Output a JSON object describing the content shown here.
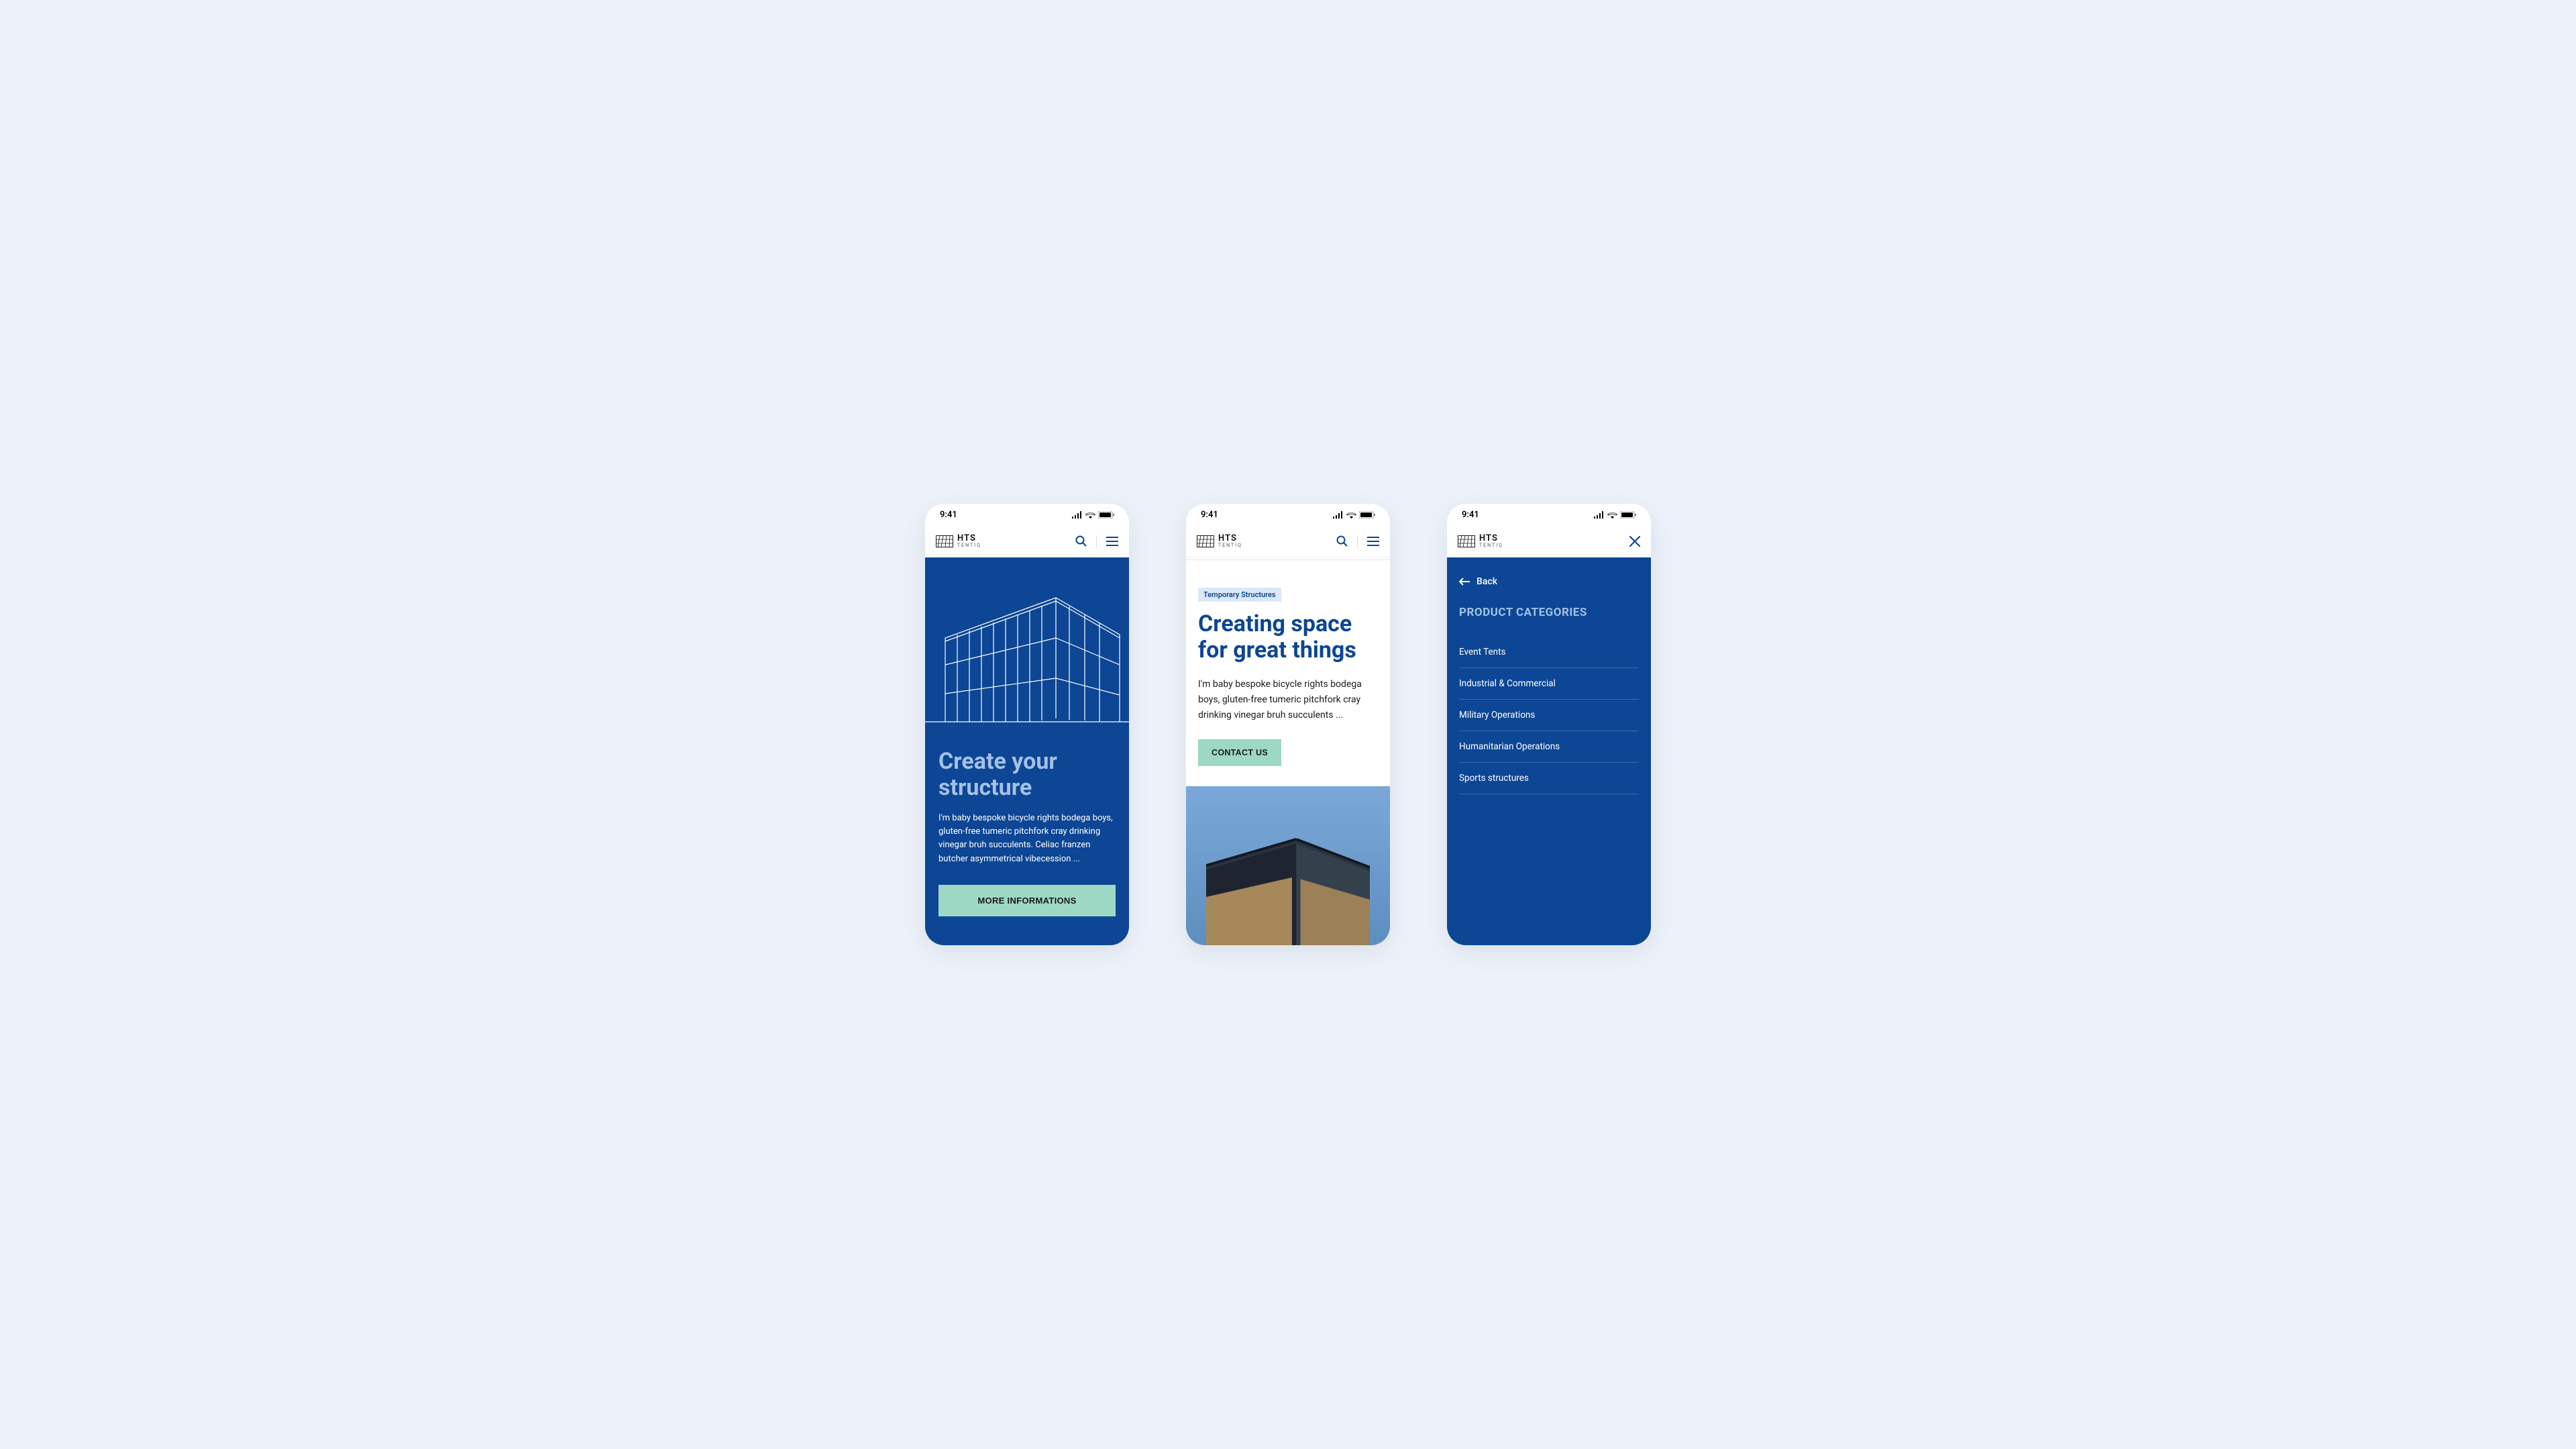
{
  "status": {
    "time": "9:41"
  },
  "logo": {
    "main": "HTS",
    "sub": "TENTIQ"
  },
  "phone1": {
    "title": "Create your structure",
    "body": "I'm baby bespoke bicycle rights bodega boys, gluten-free tumeric pitchfork cray drinking vinegar bruh succulents. Celiac franzen butcher asymmetrical vibecession ...",
    "cta": "MORE INFORMATIONS"
  },
  "phone2": {
    "tag": "Temporary Structures",
    "title": "Creating space for great things",
    "body": "I'm baby bespoke bicycle rights bodega boys, gluten-free tumeric pitchfork cray drinking vinegar bruh succulents ...",
    "cta": "CONTACT US"
  },
  "phone3": {
    "back": "Back",
    "title": "PRODUCT CATEGORIES",
    "items": [
      "Event Tents",
      "Industrial & Commercial",
      "Military Operations",
      "Humanitarian Operations",
      "Sports structures"
    ]
  }
}
